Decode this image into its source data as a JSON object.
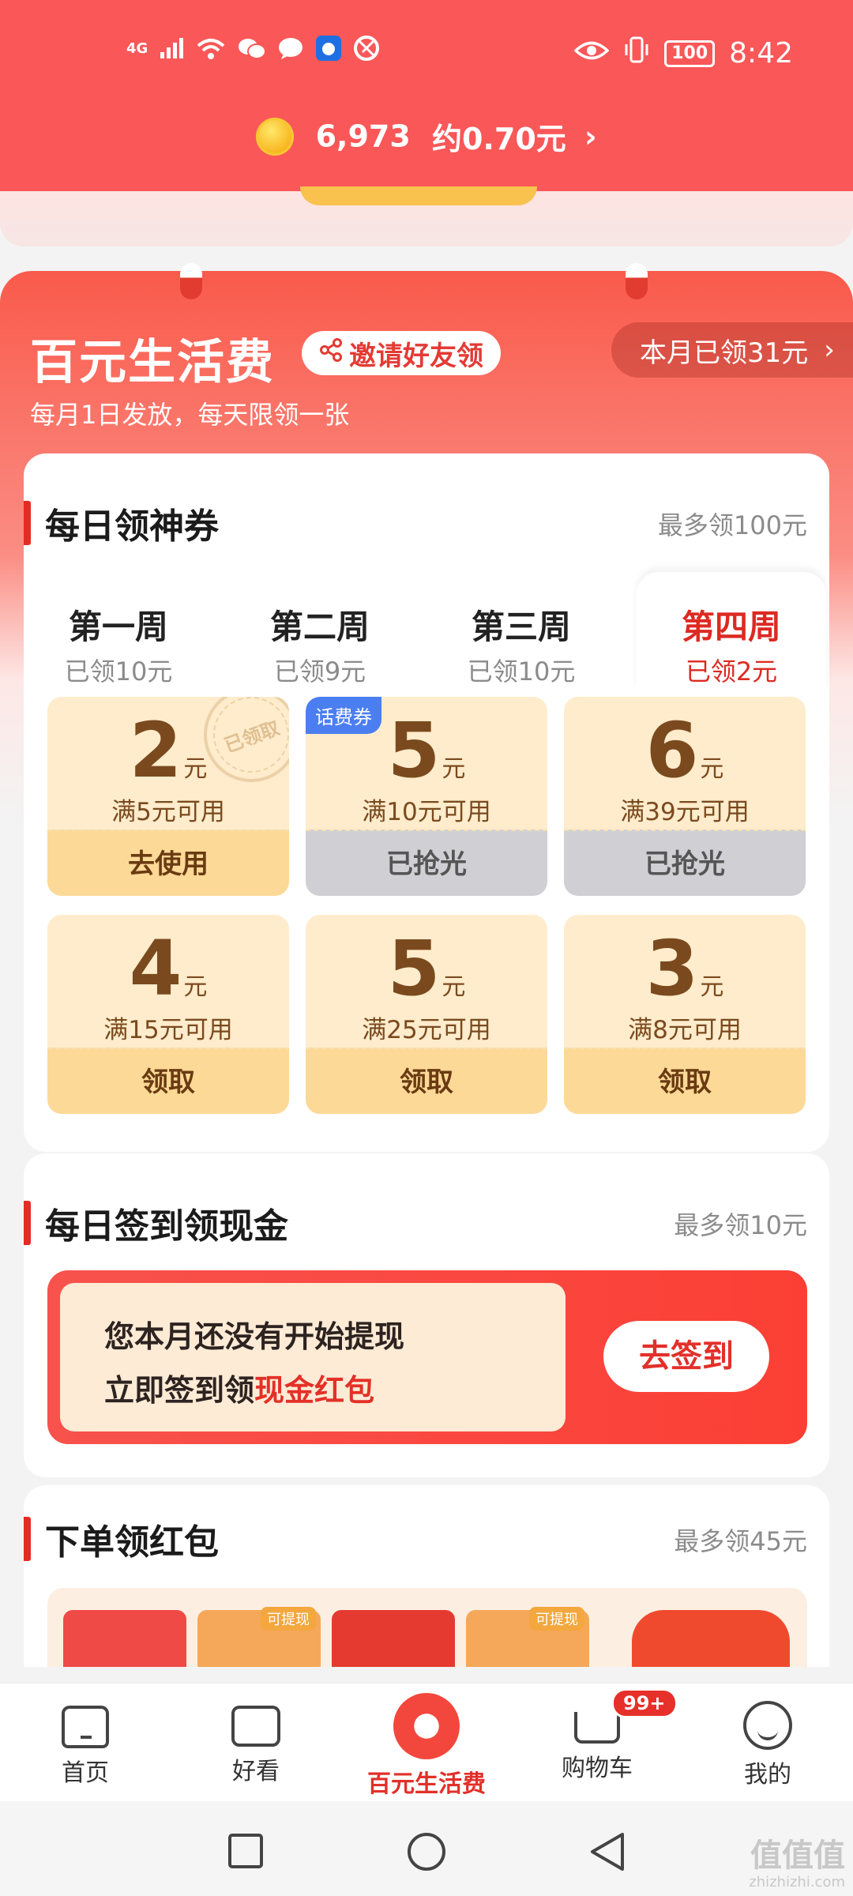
{
  "status": {
    "network": "4G",
    "time": "8:42",
    "battery": "100"
  },
  "header": {
    "coins": "6,973",
    "approx": "约0.70元",
    "arrow": "›"
  },
  "hero": {
    "title": "百元生活费",
    "invite_label": "邀请好友领",
    "description": "每月1日发放，每天限领一张",
    "month_claimed": "本月已领31元",
    "month_arrow": "›"
  },
  "daily_coupons": {
    "title": "每日领神券",
    "max": "最多领100元",
    "weeks": [
      {
        "name": "第一周",
        "value": "已领10元"
      },
      {
        "name": "第二周",
        "value": "已领9元"
      },
      {
        "name": "第三周",
        "value": "已领10元"
      },
      {
        "name": "第四周",
        "value": "已领2元"
      }
    ],
    "active_week": 3,
    "coupons": [
      {
        "amount": "2",
        "unit": "元",
        "condition": "满5元可用",
        "action": "去使用",
        "stamp": "已领取"
      },
      {
        "amount": "5",
        "unit": "元",
        "condition": "满10元可用",
        "action": "已抢光",
        "tag": "话费券"
      },
      {
        "amount": "6",
        "unit": "元",
        "condition": "满39元可用",
        "action": "已抢光"
      },
      {
        "amount": "4",
        "unit": "元",
        "condition": "满15元可用",
        "action": "领取"
      },
      {
        "amount": "5",
        "unit": "元",
        "condition": "满25元可用",
        "action": "领取"
      },
      {
        "amount": "3",
        "unit": "元",
        "condition": "满8元可用",
        "action": "领取"
      }
    ]
  },
  "sign_in": {
    "title": "每日签到领现金",
    "max": "最多领10元",
    "line1": "您本月还没有开始提现",
    "line2_prefix": "立即签到领",
    "line2_highlight": "现金红包",
    "button": "去签到"
  },
  "order": {
    "title": "下单领红包",
    "max": "最多领45元",
    "envelope_tag": "可提现"
  },
  "bottom_nav": [
    {
      "label": "首页",
      "icon": "home-icon"
    },
    {
      "label": "好看",
      "icon": "video-icon"
    },
    {
      "label": "百元生活费",
      "icon": "red-envelope-icon"
    },
    {
      "label": "购物车",
      "icon": "cart-icon",
      "badge": "99+"
    },
    {
      "label": "我的",
      "icon": "profile-icon"
    }
  ],
  "watermark": {
    "main": "值值值",
    "sub": "zhizhizhi.com"
  },
  "colors": {
    "brand_red": "#fa5758",
    "accent_red": "#e2302a",
    "coupon_bg": "#feeccc",
    "coupon_btn": "#fcd997",
    "sold_out": "#cfcfd4"
  }
}
